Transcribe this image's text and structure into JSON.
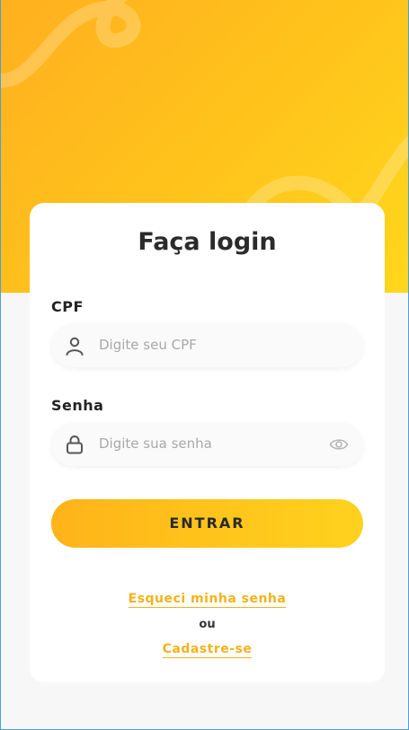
{
  "login": {
    "title": "Faça login",
    "cpf_label": "CPF",
    "cpf_placeholder": "Digite seu CPF",
    "password_label": "Senha",
    "password_placeholder": "Digite sua senha",
    "submit_label": "ENTRAR",
    "forgot_link": "Esqueci minha senha",
    "separator": "ou",
    "signup_link": "Cadastre-se"
  },
  "theme": {
    "accent": "#ffc21b",
    "link": "#f6b21b",
    "text": "#2b2b2b"
  },
  "icons": {
    "cpf_field": "user-icon",
    "password_field": "lock-icon",
    "toggle_password": "eye-icon"
  }
}
